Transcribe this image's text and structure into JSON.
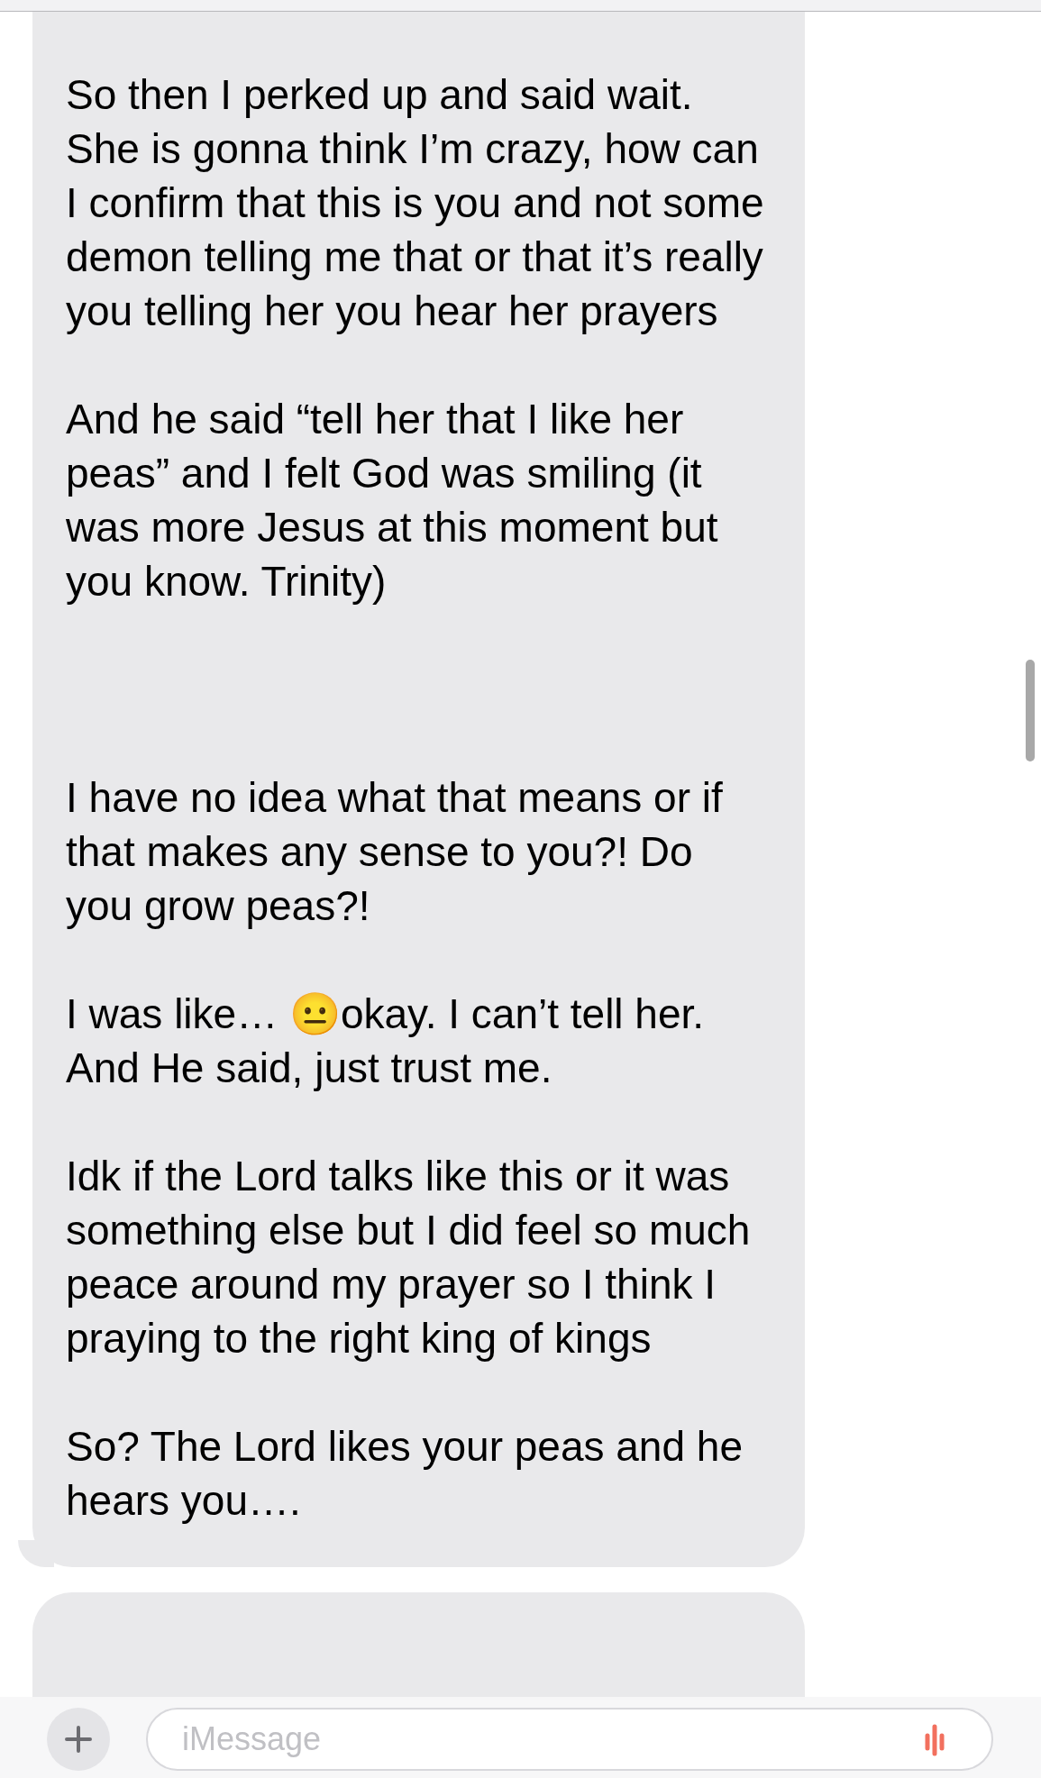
{
  "messages": [
    {
      "kind": "received",
      "text": "So then I perked up and said wait. She is gonna think I’m crazy, how can I confirm that this is you and not some demon telling me that or that it’s really you telling her you hear her prayers\n\nAnd he said “tell her that I like her peas” and I felt God was smiling (it was more Jesus at this moment but you know. Trinity)\n\n\n\nI have no idea what that means or if that makes any sense to you?! Do you grow peas?!\n\nI was like… 😐okay. I can’t tell her. And He said, just trust me.\n\nIdk if the Lord talks like this or it was something else but I did feel so much peace around my prayer so I think I praying to the right king of kings\n\nSo? The Lord likes your peas and he hears you…."
    },
    {
      "kind": "received_hidden"
    }
  ],
  "composer": {
    "placeholder": "iMessage"
  }
}
